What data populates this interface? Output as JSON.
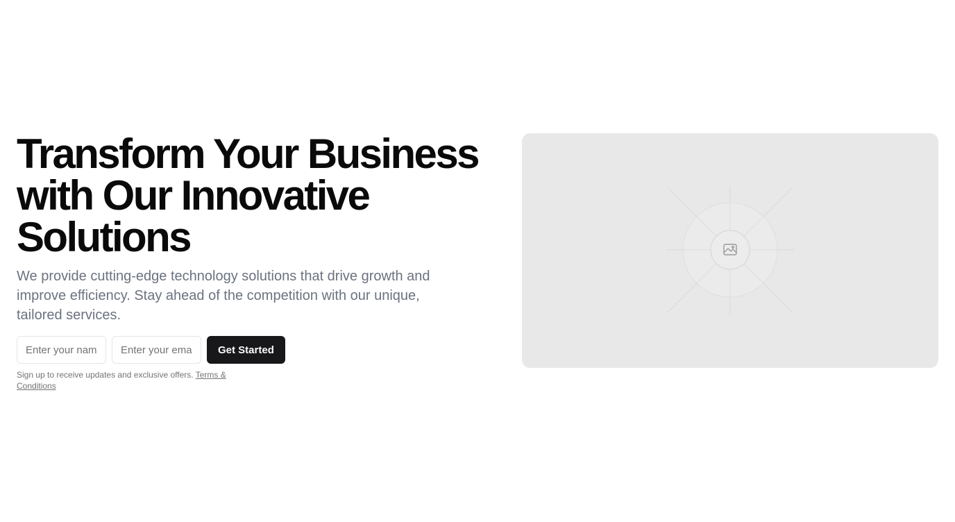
{
  "hero": {
    "headline": "Transform Your Business with Our Innovative Solutions",
    "description": "We provide cutting-edge technology solutions that drive growth and improve efficiency. Stay ahead of the competition with our unique, tailored services.",
    "form": {
      "name_placeholder": "Enter your name",
      "email_placeholder": "Enter your email",
      "submit_label": "Get Started"
    },
    "disclaimer": {
      "text": "Sign up to receive updates and exclusive offers. ",
      "link_label": "Terms & Conditions"
    },
    "media": {
      "icon": "image-placeholder-icon"
    }
  },
  "colors": {
    "text_primary": "#0a0a0a",
    "text_muted": "#6b7280",
    "button_bg": "#18181b",
    "placeholder_bg": "#e8e8e8"
  }
}
